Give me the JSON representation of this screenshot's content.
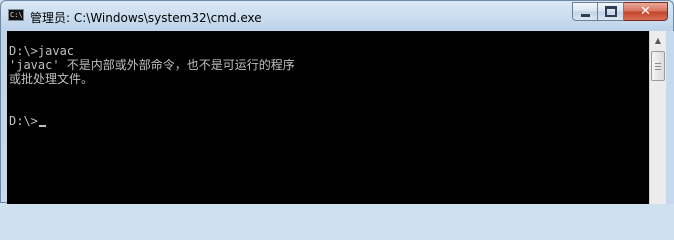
{
  "window": {
    "title": "管理员: C:\\Windows\\system32\\cmd.exe",
    "app_icon": "cmd-icon",
    "app_icon_text": "C:\\",
    "buttons": {
      "minimize": "minimize-icon",
      "maximize": "maximize-icon",
      "close": "close-icon",
      "close_glyph": "✕"
    }
  },
  "console": {
    "lines": [
      "D:\\>javac",
      "'javac' 不是内部或外部命令，也不是可运行的程序",
      "或批处理文件。",
      "",
      "D:\\>"
    ],
    "text_color": "#c0c0c0",
    "background_color": "#000000"
  },
  "scrollbar": {
    "up_glyph": "▲",
    "down_glyph": "▼"
  }
}
